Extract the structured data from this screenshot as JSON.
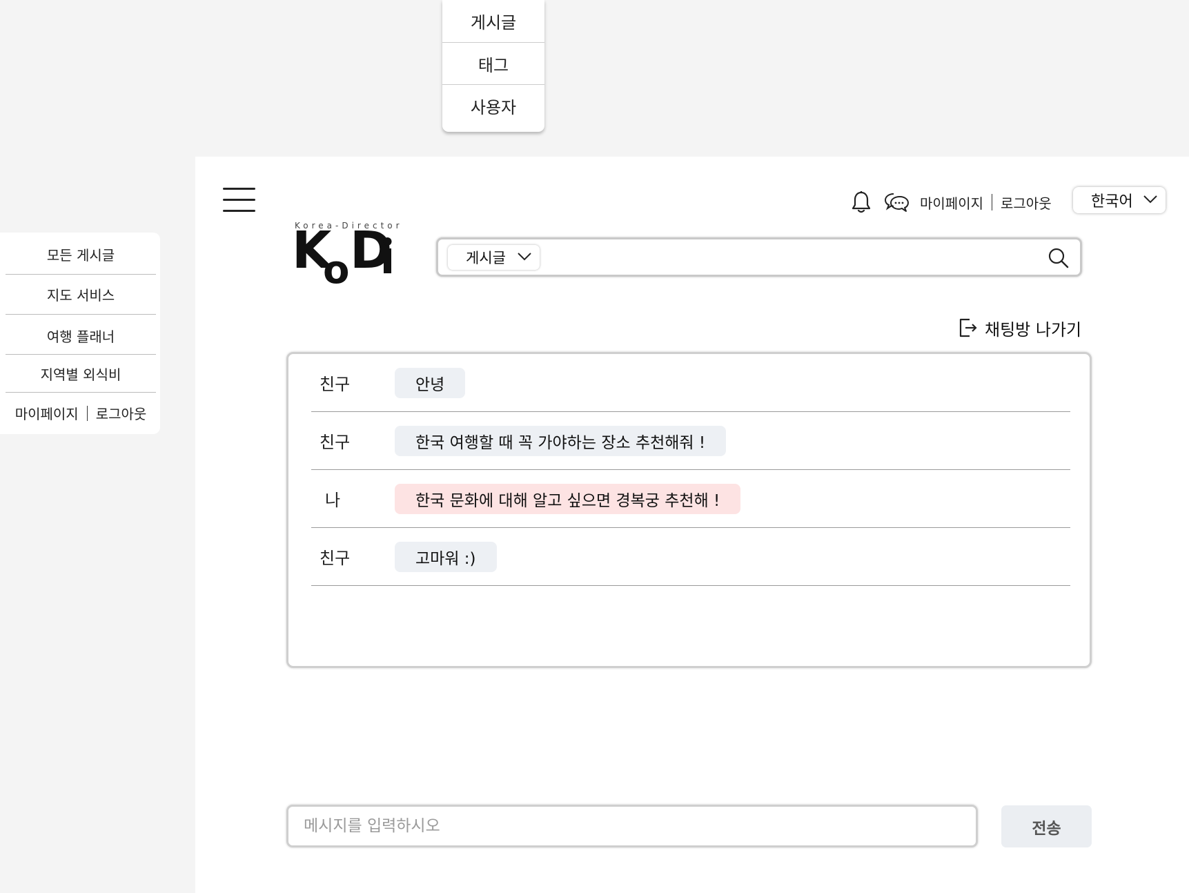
{
  "type_dropdown": {
    "options": [
      "게시글",
      "태그",
      "사용자"
    ]
  },
  "side_menu": {
    "items": [
      "모든 게시글",
      "지도 서비스",
      "여행 플래너",
      "지역별 외식비"
    ],
    "mypage": "마이페이지",
    "logout": "로그아웃"
  },
  "header": {
    "mypage": "마이페이지",
    "logout": "로그아웃",
    "language": "한국어",
    "icons": [
      "bell-icon",
      "chat-icon"
    ]
  },
  "logo": {
    "tagline": "Korea-Director",
    "wordmark": "KoDi"
  },
  "search": {
    "type": "게시글",
    "placeholder": ""
  },
  "chat": {
    "leave_label": "채팅방 나가기",
    "messages": [
      {
        "sender": "친구",
        "text": "안녕",
        "mine": false
      },
      {
        "sender": "친구",
        "text": "한국 여행할 때 꼭 가야하는 장소 추천해줘 !",
        "mine": false
      },
      {
        "sender": "나",
        "text": "한국 문화에 대해 알고 싶으면 경복궁 추천해 !",
        "mine": true
      },
      {
        "sender": "친구",
        "text": "고마워 :)",
        "mine": false
      }
    ],
    "input_placeholder": "메시지를 입력하시오",
    "send_label": "전송"
  },
  "colors": {
    "background": "#f4f4f4",
    "friend_bubble": "#edf0f4",
    "my_bubble": "#fde3e3",
    "send_button": "#ebeef2"
  }
}
